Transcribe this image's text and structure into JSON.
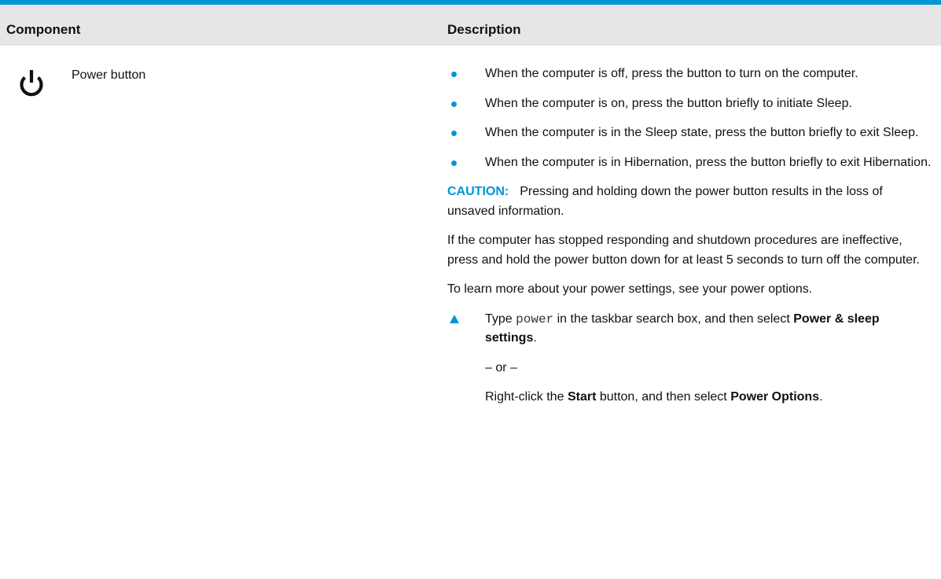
{
  "table": {
    "headers": {
      "component": "Component",
      "description": "Description"
    },
    "row": {
      "icon": "power-icon",
      "component_name": "Power button",
      "bullets": [
        "When the computer is off, press the button to turn on the computer.",
        "When the computer is on, press the button briefly to initiate Sleep.",
        "When the computer is in the Sleep state, press the button briefly to exit Sleep.",
        "When the computer is in Hibernation, press the button briefly to exit Hibernation."
      ],
      "caution": {
        "label": "CAUTION:",
        "text": "Pressing and holding down the power button results in the loss of unsaved information."
      },
      "unresponsive_text": "If the computer has stopped responding and shutdown procedures are ineffective, press and hold the power button down for at least 5 seconds to turn off the computer.",
      "learn_more": "To learn more about your power settings, see your power options.",
      "step": {
        "type_word": "Type",
        "code": "power",
        "middle": "in the taskbar search box, and then select",
        "target": "Power & sleep settings",
        "end": "."
      },
      "or_text": "– or –",
      "alt": {
        "pre": "Right-click the",
        "start": "Start",
        "mid": "button, and then select",
        "target": "Power Options",
        "end": "."
      }
    }
  },
  "colors": {
    "accent": "#0096d6",
    "header_bg": "#e6e6e6"
  }
}
